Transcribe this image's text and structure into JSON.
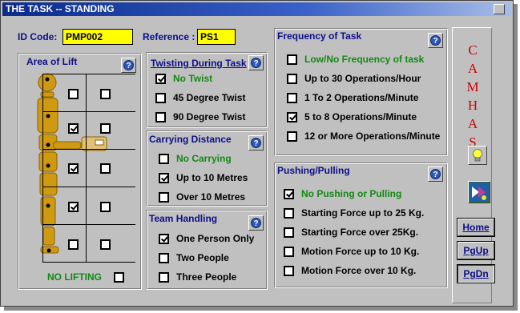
{
  "window": {
    "title": "THE TASK -- STANDING"
  },
  "header": {
    "id_label": "ID Code:",
    "id_value": "PMP002",
    "ref_label": "Reference :",
    "ref_value": "PS1"
  },
  "area_of_lift": {
    "title": "Area of Lift",
    "rows": [
      {
        "left": false,
        "right": false
      },
      {
        "left": true,
        "right": false
      },
      {
        "left": true,
        "right": false
      },
      {
        "left": true,
        "right": false
      },
      {
        "left": false,
        "right": false
      }
    ],
    "no_lifting_label": "NO LIFTING",
    "no_lifting_checked": false
  },
  "twisting": {
    "title": "Twisting During Task",
    "options": [
      {
        "label": "No Twist",
        "checked": true,
        "green": true
      },
      {
        "label": "45 Degree Twist",
        "checked": false,
        "green": false
      },
      {
        "label": "90 Degree Twist",
        "checked": false,
        "green": false
      }
    ]
  },
  "carrying": {
    "title": "Carrying Distance",
    "options": [
      {
        "label": "No Carrying",
        "checked": false,
        "green": true
      },
      {
        "label": "Up to 10 Metres",
        "checked": true,
        "green": false
      },
      {
        "label": "Over 10 Metres",
        "checked": false,
        "green": false
      }
    ]
  },
  "team": {
    "title": "Team Handling",
    "options": [
      {
        "label": "One Person Only",
        "checked": true,
        "green": false
      },
      {
        "label": "Two People",
        "checked": false,
        "green": false
      },
      {
        "label": "Three People",
        "checked": false,
        "green": false
      }
    ]
  },
  "frequency": {
    "title": "Frequency of Task",
    "options": [
      {
        "label": "Low/No Frequency of task",
        "checked": false,
        "green": true
      },
      {
        "label": "Up to 30 Operations/Hour",
        "checked": false,
        "green": false
      },
      {
        "label": "1 To 2 Operations/Minute",
        "checked": false,
        "green": false
      },
      {
        "label": "5 to 8 Operations/Minute",
        "checked": true,
        "green": false
      },
      {
        "label": "12 or More Operations/Minute",
        "checked": false,
        "green": false
      }
    ]
  },
  "pushing": {
    "title": "Pushing/Pulling",
    "options": [
      {
        "label": "No Pushing or Pulling",
        "checked": true,
        "green": true
      },
      {
        "label": "Starting Force up to 25 Kg.",
        "checked": false,
        "green": false
      },
      {
        "label": "Starting Force over 25Kg.",
        "checked": false,
        "green": false
      },
      {
        "label": "Motion Force up to 10 Kg.",
        "checked": false,
        "green": false
      },
      {
        "label": "Motion Force over 10 Kg.",
        "checked": false,
        "green": false
      }
    ]
  },
  "sidebar": {
    "letters": [
      "C",
      "A",
      "M",
      "H",
      "A",
      "S"
    ],
    "icons": [
      "lightbulb-icon",
      "arrows-icon"
    ],
    "buttons": {
      "home": "Home",
      "pgup": "PgUp",
      "pgdn": "PgDn"
    }
  },
  "help_label": "?"
}
